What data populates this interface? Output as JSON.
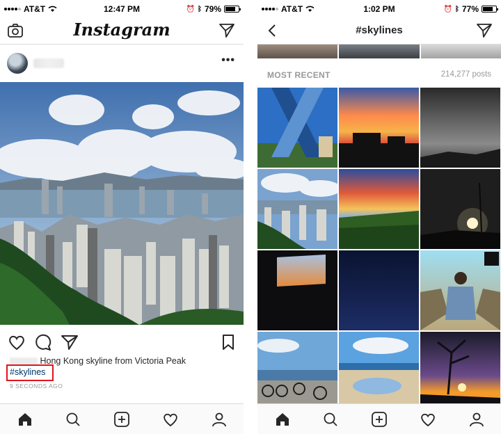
{
  "left": {
    "status": {
      "carrier": "AT&T",
      "time": "12:47 PM",
      "battery": "79%",
      "battery_level": 0.79
    },
    "header": {
      "logo": "Instagram",
      "left_icon": "camera-icon",
      "right_icon": "send-icon"
    },
    "post": {
      "more_label": "•••",
      "caption_text": "Hong Kong skyline from Victoria Peak",
      "hashtag": "#skylines",
      "timestamp": "9 SECONDS AGO"
    },
    "tabs": [
      "home-icon",
      "search-icon",
      "add-icon",
      "heart-icon",
      "profile-icon"
    ]
  },
  "right": {
    "status": {
      "carrier": "AT&T",
      "time": "1:02 PM",
      "battery": "77%",
      "battery_level": 0.77
    },
    "header": {
      "title": "#skylines",
      "left_icon": "back-arrow-icon",
      "right_icon": "send-icon"
    },
    "section": {
      "title": "MOST RECENT",
      "count": "214,277 posts"
    },
    "tabs": [
      "home-icon",
      "search-icon",
      "add-icon",
      "heart-icon",
      "profile-icon"
    ]
  },
  "colors": {
    "hashtag_link": "#003569",
    "highlight_box": "#e0141e"
  }
}
